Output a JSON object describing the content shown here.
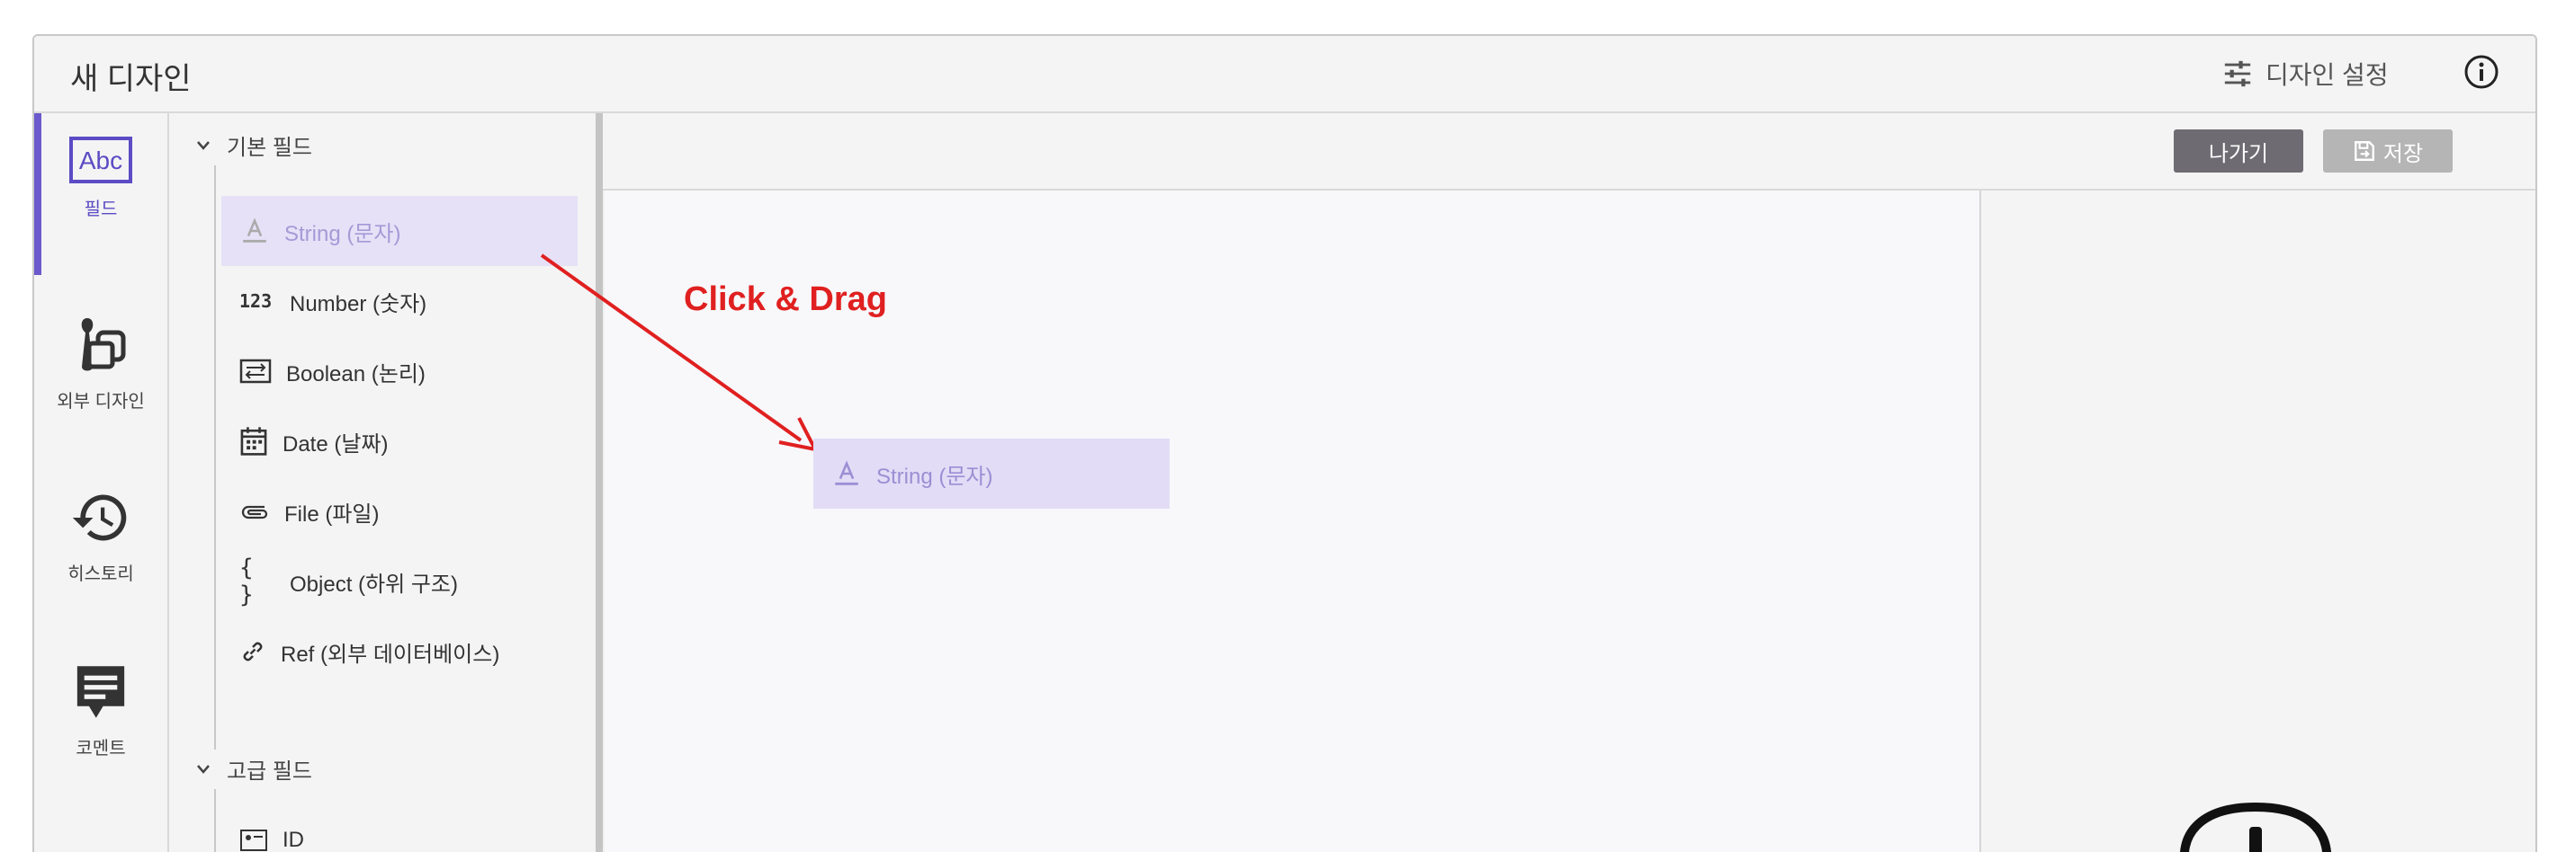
{
  "window": {
    "title": "새 디자인"
  },
  "header": {
    "design_settings_label": "디자인 설정",
    "settings_icon": "sliders-icon",
    "info_icon": "info-icon"
  },
  "sidebar": {
    "items": [
      {
        "label": "필드",
        "icon": "abc-text-icon",
        "active": true
      },
      {
        "label": "외부 디자인",
        "icon": "external-design-icon",
        "active": false
      },
      {
        "label": "히스토리",
        "icon": "history-icon",
        "active": false
      },
      {
        "label": "코멘트",
        "icon": "comment-icon",
        "active": false
      }
    ]
  },
  "field_panel": {
    "basic": {
      "title": "기본 필드",
      "items": [
        {
          "label": "String (문자)",
          "icon": "text-a-icon"
        },
        {
          "label": "Number (숫자)",
          "icon": "number-123-icon",
          "icon_text": "123"
        },
        {
          "label": "Boolean (논리)",
          "icon": "boolean-toggle-icon"
        },
        {
          "label": "Date (날짜)",
          "icon": "calendar-icon"
        },
        {
          "label": "File (파일)",
          "icon": "paperclip-icon"
        },
        {
          "label": "Object (하위 구조)",
          "icon": "braces-icon",
          "icon_text": "{ }"
        },
        {
          "label": "Ref (외부 데이터베이스)",
          "icon": "link-icon"
        }
      ]
    },
    "advanced": {
      "title": "고급 필드",
      "items": [
        {
          "label": "ID",
          "icon": "id-card-icon"
        }
      ]
    }
  },
  "toolbar": {
    "exit_label": "나가기",
    "save_label": "저장"
  },
  "annotation": {
    "text": "Click & Drag"
  },
  "drag_ghost": {
    "label": "String (문자)"
  },
  "colors": {
    "accent": "#6a5acd",
    "selected_bg": "#e6e1f7",
    "annotation": "#e02020"
  }
}
